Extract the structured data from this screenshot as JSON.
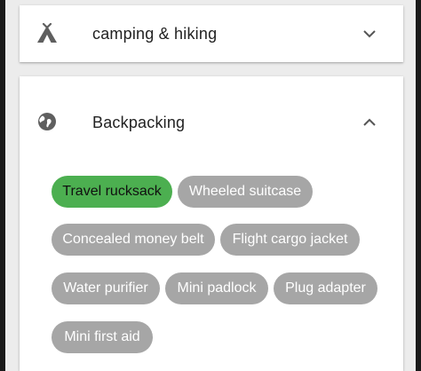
{
  "sections": [
    {
      "label": "camping & hiking",
      "icon": "tent-icon",
      "expanded": false
    },
    {
      "label": "Backpacking",
      "icon": "globe-icon",
      "expanded": true
    }
  ],
  "chips": [
    {
      "label": "Travel rucksack",
      "selected": true
    },
    {
      "label": "Wheeled suitcase",
      "selected": false
    },
    {
      "label": "Concealed money belt",
      "selected": false
    },
    {
      "label": "Flight cargo jacket",
      "selected": false
    },
    {
      "label": "Water purifier",
      "selected": false
    },
    {
      "label": "Mini padlock",
      "selected": false
    },
    {
      "label": "Plug adapter",
      "selected": false
    },
    {
      "label": "Mini first aid",
      "selected": false
    }
  ],
  "colors": {
    "chip_selected": "#4caf50",
    "chip_default": "#a6a6a6",
    "card_background": "#ffffff",
    "page_background": "#ececec"
  }
}
